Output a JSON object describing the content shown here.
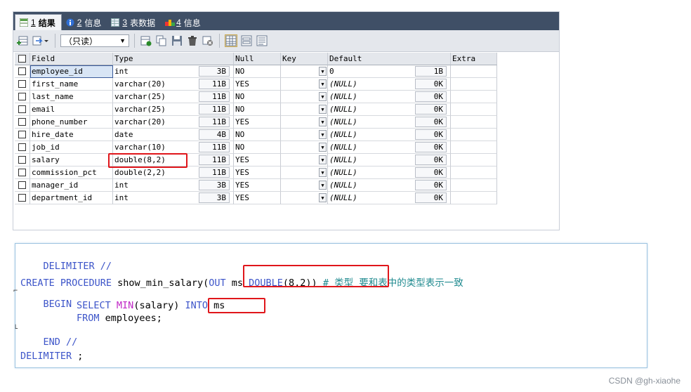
{
  "tabs": [
    {
      "num": "1",
      "label": "结果",
      "icon": "result-grid-icon",
      "active": true
    },
    {
      "num": "2",
      "label": "信息",
      "icon": "info-circle-icon"
    },
    {
      "num": "3",
      "label": "表数据",
      "icon": "table-data-icon"
    },
    {
      "num": "4",
      "label": "信息",
      "icon": "colored-blocks-icon"
    }
  ],
  "toolbar": {
    "mode_select": "（只读）"
  },
  "grid": {
    "headers": [
      "Field",
      "Type",
      "Null",
      "Key",
      "Default",
      "Extra"
    ],
    "rows": [
      {
        "field": "employee_id",
        "type": "int",
        "type_size": "3B",
        "null": "NO",
        "default": "0",
        "def_size": "1B"
      },
      {
        "field": "first_name",
        "type": "varchar(20)",
        "type_size": "11B",
        "null": "YES",
        "default": "(NULL)",
        "def_size": "0K"
      },
      {
        "field": "last_name",
        "type": "varchar(25)",
        "type_size": "11B",
        "null": "NO",
        "default": "(NULL)",
        "def_size": "0K"
      },
      {
        "field": "email",
        "type": "varchar(25)",
        "type_size": "11B",
        "null": "NO",
        "default": "(NULL)",
        "def_size": "0K"
      },
      {
        "field": "phone_number",
        "type": "varchar(20)",
        "type_size": "11B",
        "null": "YES",
        "default": "(NULL)",
        "def_size": "0K"
      },
      {
        "field": "hire_date",
        "type": "date",
        "type_size": "4B",
        "null": "NO",
        "default": "(NULL)",
        "def_size": "0K"
      },
      {
        "field": "job_id",
        "type": "varchar(10)",
        "type_size": "11B",
        "null": "NO",
        "default": "(NULL)",
        "def_size": "0K"
      },
      {
        "field": "salary",
        "type": "double(8,2)",
        "type_size": "11B",
        "null": "YES",
        "default": "(NULL)",
        "def_size": "0K"
      },
      {
        "field": "commission_pct",
        "type": "double(2,2)",
        "type_size": "11B",
        "null": "YES",
        "default": "(NULL)",
        "def_size": "0K"
      },
      {
        "field": "manager_id",
        "type": "int",
        "type_size": "3B",
        "null": "YES",
        "default": "(NULL)",
        "def_size": "0K"
      },
      {
        "field": "department_id",
        "type": "int",
        "type_size": "3B",
        "null": "YES",
        "default": "(NULL)",
        "def_size": "0K"
      }
    ]
  },
  "sql": {
    "l1": "DELIMITER //",
    "l3_kw": "CREATE PROCEDURE",
    "l3_name": " show_min_salary",
    "l3_open": "(",
    "l3_out": "OUT",
    "l3_param": " ms ",
    "l3_double": "DOUBLE",
    "l3_args": "(8,2))",
    "l3_comment": " # 类型 要和表中的类型表示一致",
    "l4": "BEGIN",
    "l5_select": "SELECT",
    "l5_min": "MIN",
    "l5_arg": "(salary) ",
    "l5_into": "INTO",
    "l5_ms": " ms",
    "l6_from": "FROM",
    "l6_rest": " employees;",
    "l7": "END //",
    "l9_kw": "DELIMITER",
    "l9_rest": " ;"
  },
  "colors": {
    "highlight": "#e0161b",
    "keyword": "#3d55c9",
    "function": "#c026c6",
    "comment": "#1f8a8f"
  },
  "watermark": "CSDN @gh-xiaohe"
}
